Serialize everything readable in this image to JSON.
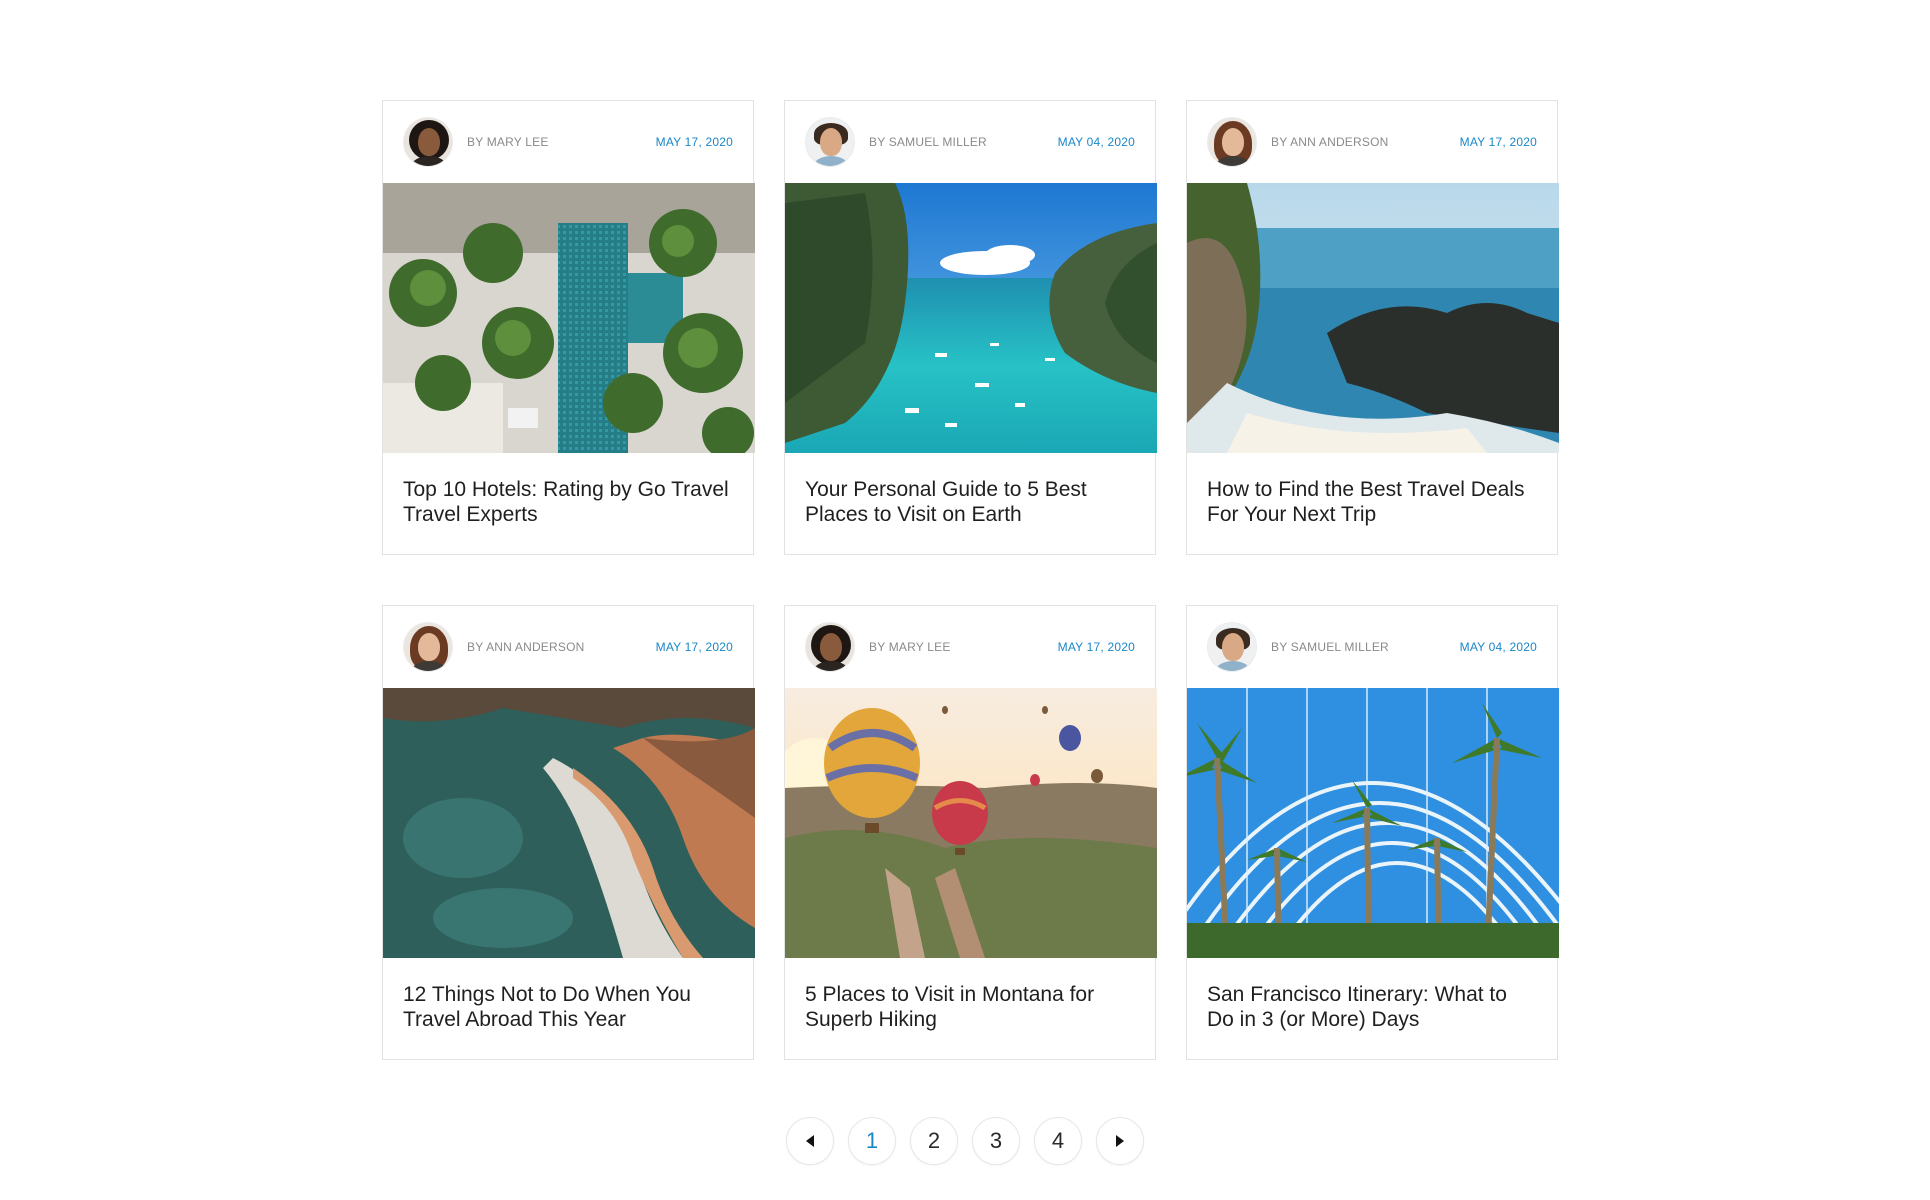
{
  "colors": {
    "accent": "#1a87c7",
    "author_text": "#8a8a8a",
    "title_text": "#1f1f1f",
    "border": "#e2e2e2"
  },
  "posts": [
    {
      "author": "BY MARY LEE",
      "date": "MAY 17, 2020",
      "title": "Top 10 Hotels: Rating by Go Travel Travel Experts",
      "avatar": "avatar-mary-lee",
      "image": "aerial-pool-palms-image"
    },
    {
      "author": "BY SAMUEL MILLER",
      "date": "MAY 04, 2020",
      "title": "Your Personal Guide to 5 Best Places to Visit on Earth",
      "avatar": "avatar-samuel-miller",
      "image": "tropical-bay-cliffs-image"
    },
    {
      "author": "BY ANN ANDERSON",
      "date": "MAY 17, 2020",
      "title": "How to Find the Best Travel Deals For Your Next Trip",
      "avatar": "avatar-ann-anderson",
      "image": "coastal-waterfall-image"
    },
    {
      "author": "BY ANN ANDERSON",
      "date": "MAY 17, 2020",
      "title": "12 Things Not to Do When You Travel Abroad This Year",
      "avatar": "avatar-ann-anderson",
      "image": "rocky-beach-aerial-image"
    },
    {
      "author": "BY MARY LEE",
      "date": "MAY 17, 2020",
      "title": "5 Places to Visit in Montana for Superb Hiking",
      "avatar": "avatar-mary-lee",
      "image": "hot-air-balloons-image"
    },
    {
      "author": "BY SAMUEL MILLER",
      "date": "MAY 04, 2020",
      "title": "San Francisco Itinerary: What to Do in 3 (or More) Days",
      "avatar": "avatar-samuel-miller",
      "image": "palm-greenhouse-image"
    }
  ],
  "pagination": {
    "prev_icon": "caret-left-icon",
    "next_icon": "caret-right-icon",
    "pages": [
      "1",
      "2",
      "3",
      "4"
    ],
    "current": "1"
  }
}
